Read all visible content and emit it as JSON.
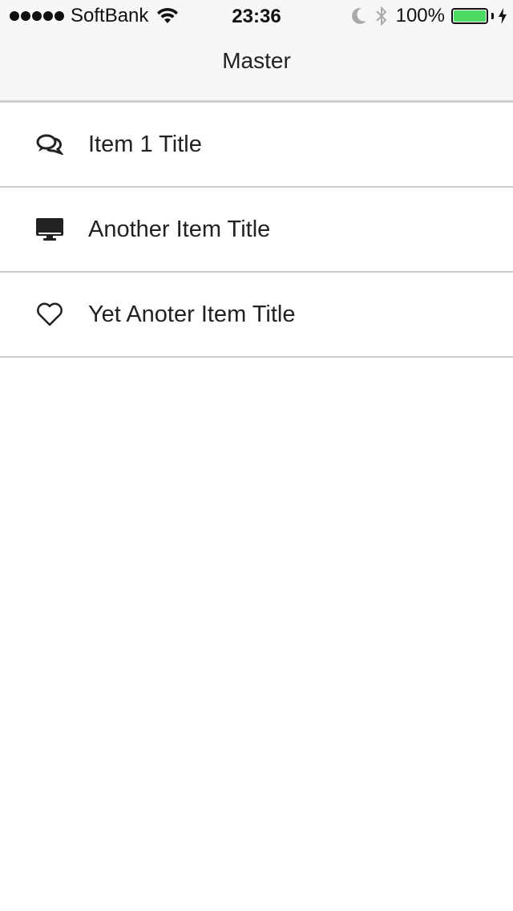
{
  "status_bar": {
    "carrier": "SoftBank",
    "time": "23:36",
    "battery_percent": "100%",
    "battery_level": 1.0,
    "signal_bars": 5,
    "icons": [
      "signal-dots",
      "wifi-icon",
      "moon-icon",
      "bluetooth-icon",
      "battery-icon",
      "charging-bolt-icon"
    ]
  },
  "nav": {
    "title": "Master"
  },
  "list": {
    "items": [
      {
        "label": "Item 1 Title",
        "icon": "chat-bubbles-icon"
      },
      {
        "label": "Another Item Title",
        "icon": "desktop-monitor-icon"
      },
      {
        "label": "Yet Anoter Item Title",
        "icon": "heart-icon"
      }
    ]
  },
  "colors": {
    "nav_background": "#f7f7f7",
    "separator": "#cccccc",
    "text": "#222222",
    "battery_fill": "#4cd964"
  }
}
